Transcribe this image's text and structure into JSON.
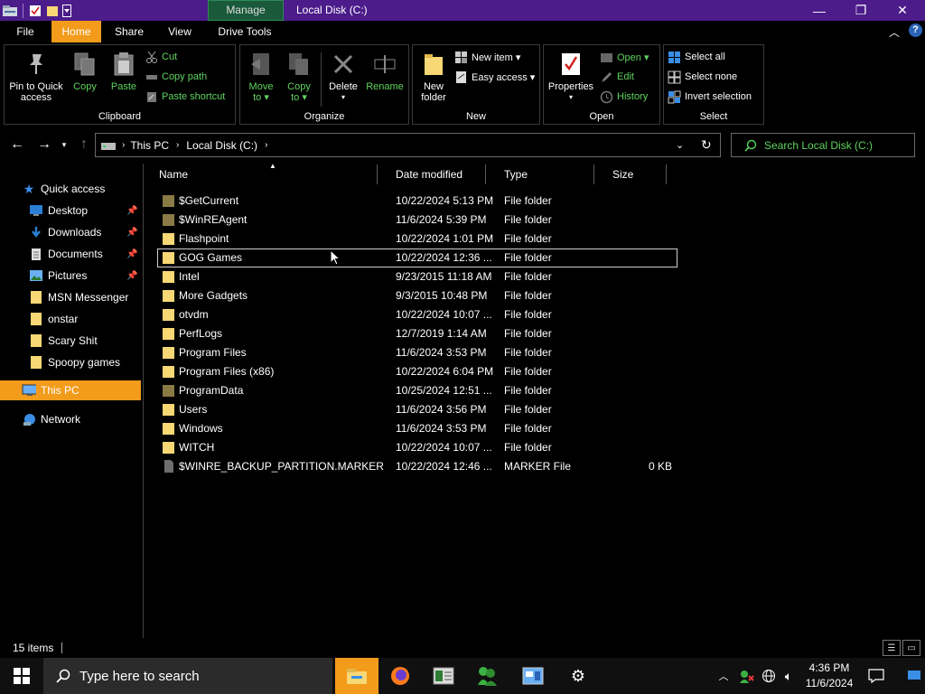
{
  "titlebar": {
    "context_tab": "Manage",
    "title": "Local Disk (C:)",
    "controls": {
      "minimize": "—",
      "maximize": "❐",
      "close": "✕"
    }
  },
  "ribbon_tabs": [
    "File",
    "Home",
    "Share",
    "View",
    "Drive Tools"
  ],
  "ribbon": {
    "clipboard": {
      "label": "Clipboard",
      "pin": [
        "Pin to Quick",
        "access"
      ],
      "copy": "Copy",
      "paste": "Paste",
      "cut": "Cut",
      "copy_path": "Copy path",
      "paste_shortcut": "Paste shortcut"
    },
    "organize": {
      "label": "Organize",
      "move_to": [
        "Move",
        "to ▾"
      ],
      "copy_to": [
        "Copy",
        "to ▾"
      ],
      "delete": [
        "Delete",
        "▾"
      ],
      "rename": "Rename"
    },
    "new": {
      "label": "New",
      "new_folder": [
        "New",
        "folder"
      ],
      "new_item": "New item ▾",
      "easy_access": "Easy access ▾"
    },
    "open": {
      "label": "Open",
      "properties": [
        "Properties",
        "▾"
      ],
      "open": "Open ▾",
      "edit": "Edit",
      "history": "History"
    },
    "select": {
      "label": "Select",
      "select_all": "Select all",
      "select_none": "Select none",
      "invert": "Invert selection"
    }
  },
  "address": {
    "crumbs": [
      "This PC",
      "Local Disk (C:)"
    ],
    "search_placeholder": "Search Local Disk (C:)"
  },
  "navpane": {
    "quick_access": "Quick access",
    "items": [
      {
        "label": "Desktop",
        "pinned": true
      },
      {
        "label": "Downloads",
        "pinned": true
      },
      {
        "label": "Documents",
        "pinned": true
      },
      {
        "label": "Pictures",
        "pinned": true
      },
      {
        "label": "MSN Messenger",
        "pinned": false
      },
      {
        "label": "onstar",
        "pinned": false
      },
      {
        "label": "Scary Shit",
        "pinned": false
      },
      {
        "label": "Spoopy games",
        "pinned": false
      }
    ],
    "this_pc": "This PC",
    "network": "Network"
  },
  "columns": {
    "name": "Name",
    "date": "Date modified",
    "type": "Type",
    "size": "Size"
  },
  "files": [
    {
      "name": "$GetCurrent",
      "date": "10/22/2024 5:13 PM",
      "type": "File folder",
      "size": "",
      "icon": "folder-hidden"
    },
    {
      "name": "$WinREAgent",
      "date": "11/6/2024 5:39 PM",
      "type": "File folder",
      "size": "",
      "icon": "folder-hidden"
    },
    {
      "name": "Flashpoint",
      "date": "10/22/2024 1:01 PM",
      "type": "File folder",
      "size": "",
      "icon": "folder"
    },
    {
      "name": "GOG Games",
      "date": "10/22/2024 12:36 ...",
      "type": "File folder",
      "size": "",
      "icon": "folder"
    },
    {
      "name": "Intel",
      "date": "9/23/2015 11:18 AM",
      "type": "File folder",
      "size": "",
      "icon": "folder"
    },
    {
      "name": "More Gadgets",
      "date": "9/3/2015 10:48 PM",
      "type": "File folder",
      "size": "",
      "icon": "folder"
    },
    {
      "name": "otvdm",
      "date": "10/22/2024 10:07 ...",
      "type": "File folder",
      "size": "",
      "icon": "folder"
    },
    {
      "name": "PerfLogs",
      "date": "12/7/2019 1:14 AM",
      "type": "File folder",
      "size": "",
      "icon": "folder"
    },
    {
      "name": "Program Files",
      "date": "11/6/2024 3:53 PM",
      "type": "File folder",
      "size": "",
      "icon": "folder"
    },
    {
      "name": "Program Files (x86)",
      "date": "10/22/2024 6:04 PM",
      "type": "File folder",
      "size": "",
      "icon": "folder"
    },
    {
      "name": "ProgramData",
      "date": "10/25/2024 12:51 ...",
      "type": "File folder",
      "size": "",
      "icon": "folder-hidden"
    },
    {
      "name": "Users",
      "date": "11/6/2024 3:56 PM",
      "type": "File folder",
      "size": "",
      "icon": "folder"
    },
    {
      "name": "Windows",
      "date": "11/6/2024 3:53 PM",
      "type": "File folder",
      "size": "",
      "icon": "folder"
    },
    {
      "name": "WITCH",
      "date": "10/22/2024 10:07 ...",
      "type": "File folder",
      "size": "",
      "icon": "folder"
    },
    {
      "name": "$WINRE_BACKUP_PARTITION.MARKER",
      "date": "10/22/2024 12:46 ...",
      "type": "MARKER File",
      "size": "0 KB",
      "icon": "file-hidden"
    }
  ],
  "focused_file": "GOG Games",
  "status": {
    "count": "15 items"
  },
  "taskbar": {
    "search_placeholder": "Type here to search",
    "time": "4:36 PM",
    "date": "11/6/2024"
  },
  "colors": {
    "accent": "#f39b1b",
    "titlebar": "#4b1c8a",
    "ribbon_text": "#5fd35f",
    "folder": "#f8d775"
  }
}
